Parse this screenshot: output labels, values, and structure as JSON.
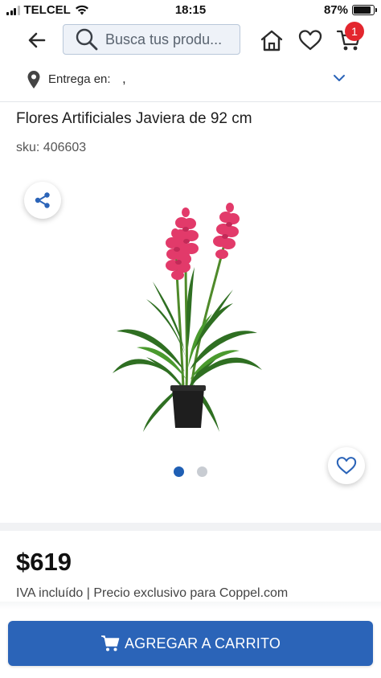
{
  "status_bar": {
    "carrier": "TELCEL",
    "time": "18:15",
    "battery_percent": "87%",
    "battery_level": 0.87
  },
  "header": {
    "search_placeholder": "Busca tus produ...",
    "icons": [
      "back-arrow-icon",
      "search-icon",
      "home-icon",
      "heart-icon",
      "cart-icon"
    ],
    "cart_count": "1",
    "badge_color": "#e3262e"
  },
  "delivery": {
    "label": "Entrega en:",
    "value": ","
  },
  "product": {
    "title": "Flores Artificiales Javiera de 92 cm",
    "sku_label": "sku:",
    "sku": "406603",
    "image_dots": 2,
    "active_dot": 0,
    "price": "$619",
    "price_note": "IVA incluído | Precio exclusivo para Coppel.com"
  },
  "cta": {
    "label": "AGREGAR A CARRITO",
    "color": "#2b64b8"
  }
}
